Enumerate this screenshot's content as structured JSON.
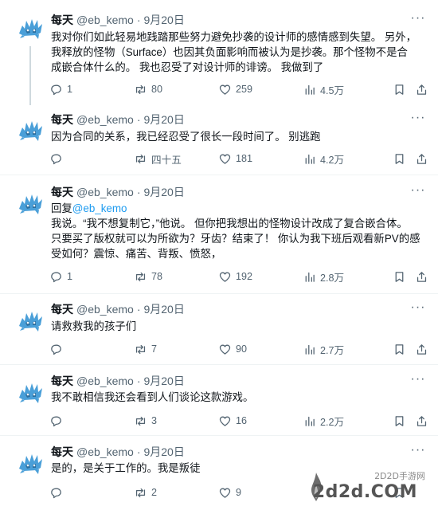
{
  "colors": {
    "accent": "#1d9bf0",
    "text": "#0f1419",
    "muted": "#536471",
    "divider": "#eff3f4"
  },
  "tweets": [
    {
      "name": "每天",
      "handle": "@eb_kemo",
      "date": "9月20日",
      "lines": [
        "我对你们如此轻易地践踏那些努力避免抄袭的设计师的感情感到失望。 另外，",
        "我释放的怪物（Surface）也因其负面影响而被认为是抄袭。那个怪物不是合",
        "成嵌合体什么的。 我也忍受了对设计师的诽谤。 我做到了"
      ],
      "replies": "1",
      "retweets": "80",
      "likes": "259",
      "views": "4.5万"
    },
    {
      "name": "每天",
      "handle": "@eb_kemo",
      "date": "9月20日",
      "lines": [
        "因为合同的关系，我已经忍受了很长一段时间了。 别逃跑"
      ],
      "replies": "",
      "retweets": "四十五",
      "likes": "181",
      "views": "4.2万"
    },
    {
      "name": "每天",
      "handle": "@eb_kemo",
      "date": "9月20日",
      "reply_prefix": "回复",
      "reply_handle": "@eb_kemo",
      "lines": [
        "我说。“我不想复制它，”他说。 但你把我想出的怪物设计改成了复合嵌合体。",
        "只要买了版权就可以为所欲为？牙齿？结束了！ 你认为我下班后观看新PV的感",
        "受如何？震惊、痛苦、背叛、愤怒，"
      ],
      "replies": "1",
      "retweets": "78",
      "likes": "192",
      "views": "2.8万"
    },
    {
      "name": "每天",
      "handle": "@eb_kemo",
      "date": "9月20日",
      "lines": [
        "请救救我的孩子们"
      ],
      "replies": "",
      "retweets": "7",
      "likes": "90",
      "views": "2.7万"
    },
    {
      "name": "每天",
      "handle": "@eb_kemo",
      "date": "9月20日",
      "lines": [
        "我不敢相信我还会看到人们谈论这款游戏。"
      ],
      "replies": "",
      "retweets": "3",
      "likes": "16",
      "views": "2.2万"
    },
    {
      "name": "每天",
      "handle": "@eb_kemo",
      "date": "9月20日",
      "lines": [
        "是的，是关于工作的。我是叛徒"
      ],
      "replies": "",
      "retweets": "2",
      "likes": "9",
      "views": ""
    }
  ],
  "watermark": {
    "site_label": "2D2D手游网",
    "site_domain": "2d2d.COM"
  }
}
